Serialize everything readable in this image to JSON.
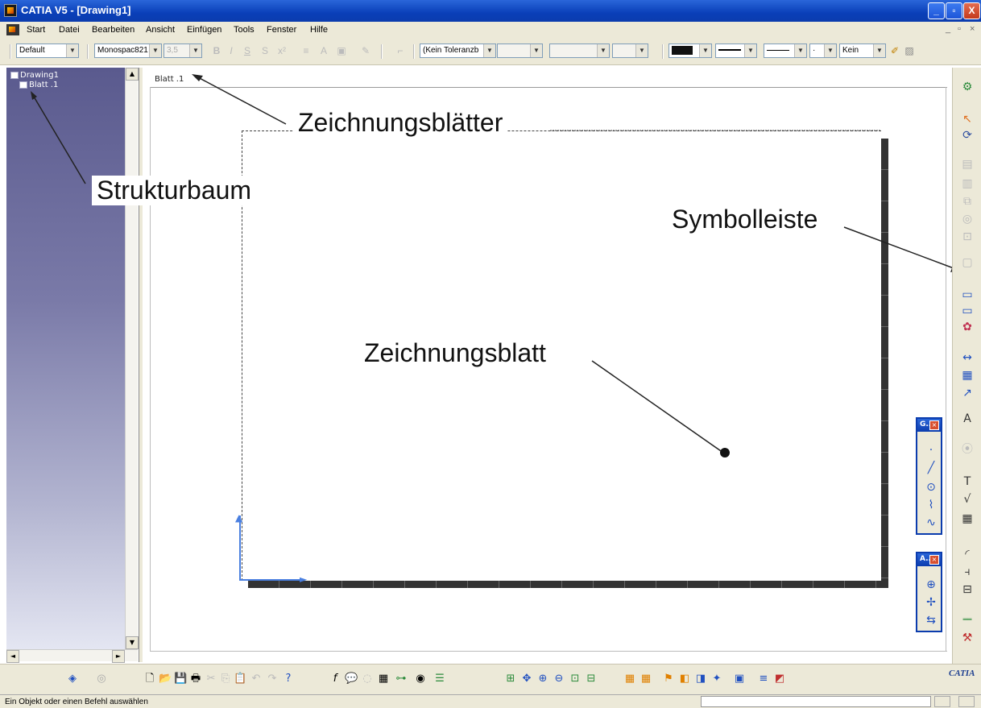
{
  "window": {
    "title": "CATIA V5 - [Drawing1]",
    "minimize": "_",
    "restore": "▫",
    "close": "X"
  },
  "menu": {
    "items": [
      "Start",
      "Datei",
      "Bearbeiten",
      "Ansicht",
      "Einfügen",
      "Tools",
      "Fenster",
      "Hilfe"
    ],
    "mdi_min": "_",
    "mdi_restore": "▫",
    "mdi_close": "×"
  },
  "toolbar": {
    "style_combo": "Default",
    "font_combo": "Monospac821",
    "size_combo": "3,5",
    "tolerance_combo": "(Kein Toleranzb",
    "line_type_combo": "Kein"
  },
  "tree": {
    "root": "Drawing1",
    "child": "Blatt .1"
  },
  "sheet_tab": "Blatt .1",
  "callouts": {
    "sheets": "Zeichnungsblätter",
    "tree": "Strukturbaum",
    "toolbar": "Symbolleiste",
    "sheet": "Zeichnungsblatt"
  },
  "floating_panels": {
    "geometry": "G..",
    "annotation": "A.."
  },
  "logo": "CATIA",
  "status": {
    "message": "Ein Objekt oder einen Befehl auswählen"
  }
}
